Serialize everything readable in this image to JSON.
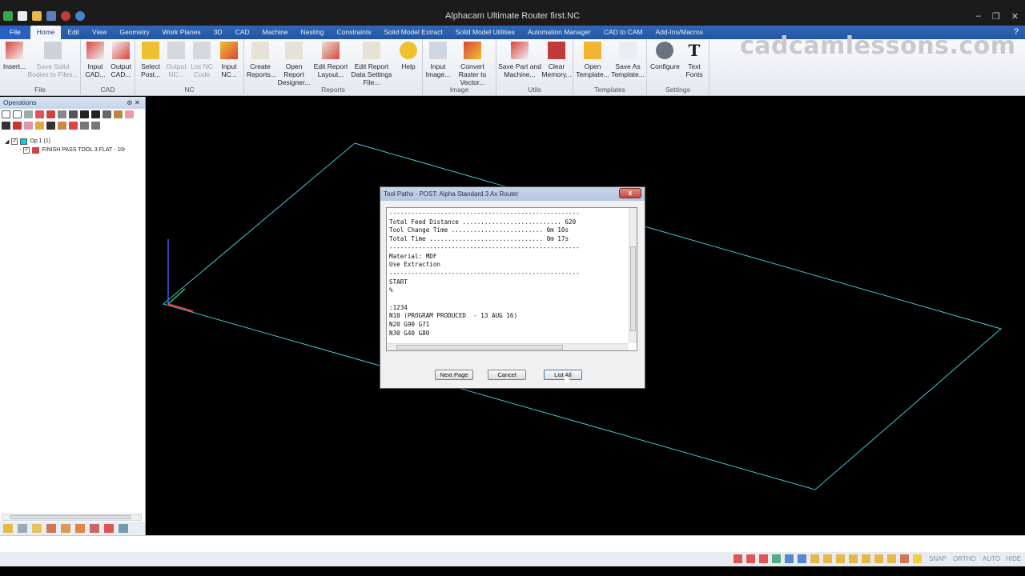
{
  "window": {
    "title": "Alphacam Ultimate Router first.NC"
  },
  "ribbon": {
    "file_tab": "File",
    "tabs": [
      "Home",
      "Edit",
      "View",
      "Geometry",
      "Work Planes",
      "3D",
      "CAD",
      "Machine",
      "Nesting",
      "Constraints",
      "Solid Model Extract",
      "Solid Model Utilities",
      "Automation Manager",
      "CAD to CAM",
      "Add-Ins/Macros"
    ],
    "active_tab": "Home",
    "help": "?",
    "groups": [
      {
        "label": "File",
        "buttons": [
          {
            "label": "Insert...",
            "disabled": false
          },
          {
            "label": "Save Solid Bodies to Files...",
            "disabled": true
          }
        ]
      },
      {
        "label": "CAD",
        "buttons": [
          {
            "label": "Input CAD...",
            "disabled": false
          },
          {
            "label": "Output CAD...",
            "disabled": false
          }
        ]
      },
      {
        "label": "NC",
        "buttons": [
          {
            "label": "Select Post...",
            "disabled": false
          },
          {
            "label": "Output NC...",
            "disabled": true
          },
          {
            "label": "List NC Code",
            "disabled": true
          },
          {
            "label": "Input NC...",
            "disabled": false
          }
        ]
      },
      {
        "label": "Reports",
        "buttons": [
          {
            "label": "Create Reports...",
            "disabled": false
          },
          {
            "label": "Open Report Designer...",
            "disabled": false
          },
          {
            "label": "Edit Report Layout...",
            "disabled": false
          },
          {
            "label": "Edit Report Data Settings File...",
            "disabled": false
          },
          {
            "label": "Help",
            "disabled": false
          }
        ]
      },
      {
        "label": "Image",
        "buttons": [
          {
            "label": "Input Image...",
            "disabled": false
          },
          {
            "label": "Convert Raster to Vector...",
            "disabled": false
          }
        ]
      },
      {
        "label": "Utils",
        "buttons": [
          {
            "label": "Save Part and Machine...",
            "disabled": false
          },
          {
            "label": "Clear Memory...",
            "disabled": false
          }
        ]
      },
      {
        "label": "Templates",
        "buttons": [
          {
            "label": "Open Template...",
            "disabled": false
          },
          {
            "label": "Save As Template...",
            "disabled": false
          }
        ]
      },
      {
        "label": "Settings",
        "buttons": [
          {
            "label": "Configure",
            "disabled": false
          },
          {
            "label": "Text Fonts",
            "disabled": false
          }
        ]
      }
    ]
  },
  "watermark": "cadcamlessons.com",
  "operations_panel": {
    "title": "Operations",
    "tree": [
      {
        "label": "Op 1  (1)",
        "checked": true,
        "color": "#00d0e0"
      },
      {
        "label": "FINISH PASS   TOOL 3   FLAT - 10r",
        "checked": true
      }
    ]
  },
  "dialog": {
    "title": "Tool Paths - POST: Alpha Standard 3 Ax Router",
    "close_label": "x",
    "lines": [
      "----------------------------------------------------",
      "Total Feed Distance ........................... 620",
      "Tool Change Time ......................... 0m 10s",
      "Total Time ............................... 0m 17s",
      "----------------------------------------------------",
      "Material: MDF",
      "Use Extraction",
      "----------------------------------------------------",
      "START",
      "%",
      "",
      ":1234",
      "N10 (PROGRAM PRODUCED  - 13 AUG 16)",
      "N20 G90 G71",
      "N30 G40 G80"
    ],
    "buttons": {
      "next_page": "Next Page",
      "cancel": "Cancel",
      "list_all": "List All"
    }
  },
  "statusbar": {
    "modes": [
      "SNAP",
      "ORTHO",
      "AUTO",
      "HIDE"
    ]
  },
  "colors": {
    "geometry": "#3fc8d8",
    "axis_x": "#e23a2a",
    "axis_y": "#2fd06a",
    "axis_z": "#3a5cff",
    "tab_bar": "#2c62b0"
  }
}
